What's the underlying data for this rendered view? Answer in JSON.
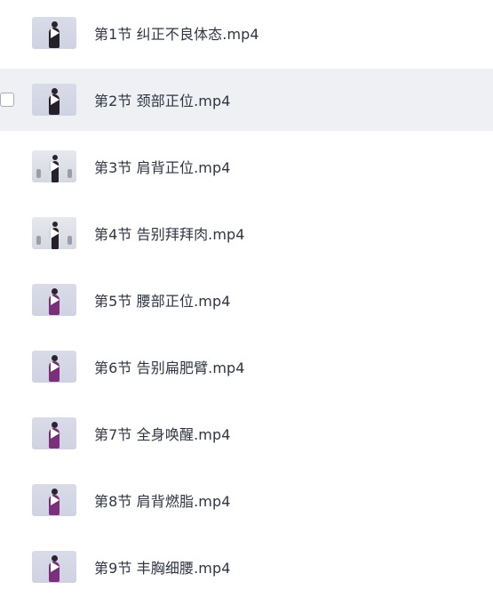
{
  "files": [
    {
      "name": "第1节  纠正不良体态.mp4",
      "thumbnail": "video-thumbnail"
    },
    {
      "name": "第2节  颈部正位.mp4",
      "thumbnail": "video-thumbnail"
    },
    {
      "name": "第3节  肩背正位.mp4",
      "thumbnail": "video-thumbnail"
    },
    {
      "name": "第4节  告别拜拜肉.mp4",
      "thumbnail": "video-thumbnail"
    },
    {
      "name": "第5节 腰部正位.mp4",
      "thumbnail": "video-thumbnail"
    },
    {
      "name": "第6节  告别扁肥臂.mp4",
      "thumbnail": "video-thumbnail"
    },
    {
      "name": "第7节  全身唤醒.mp4",
      "thumbnail": "video-thumbnail"
    },
    {
      "name": "第8节  肩背燃脂.mp4",
      "thumbnail": "video-thumbnail"
    },
    {
      "name": "第9节  丰胸细腰.mp4",
      "thumbnail": "video-thumbnail"
    }
  ],
  "colors": {
    "hover_row": "#eef0f3",
    "text": "#2f3542",
    "play_icon": "#ffffff"
  },
  "icons": {
    "checkbox": "checkbox-icon",
    "play": "play-icon"
  }
}
